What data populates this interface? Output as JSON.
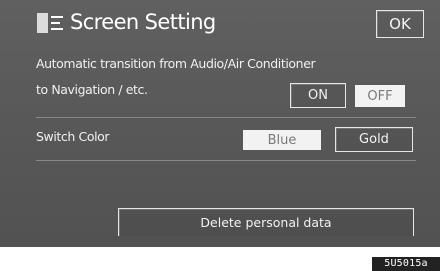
{
  "header": {
    "title": "Screen Setting",
    "title_icon": "screen-settings-icon",
    "ok_label": "OK"
  },
  "transition_setting": {
    "label_line1": "Automatic transition from Audio/Air Conditioner",
    "label_line2": "to Navigation / etc.",
    "on_label": "ON",
    "off_label": "OFF",
    "selected": "OFF"
  },
  "switch_color_setting": {
    "label": "Switch Color",
    "blue_label": "Blue",
    "gold_label": "Gold",
    "selected": "Blue"
  },
  "delete_label": "Delete personal data",
  "figure_code": "5U5015a",
  "colors": {
    "screen_background": "#585858",
    "selected_button": "#f2f2f2",
    "text": "#ffffff"
  }
}
